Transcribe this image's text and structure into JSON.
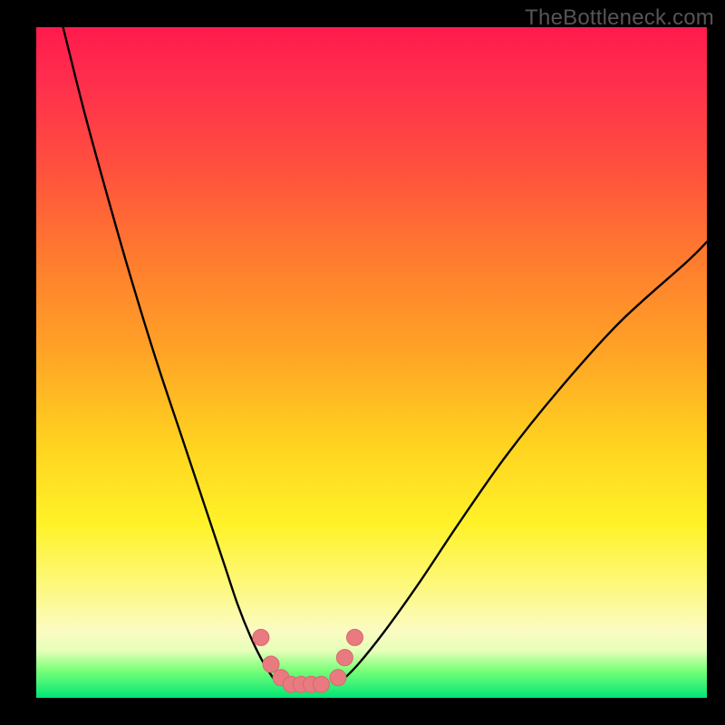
{
  "brand": "TheBottleneck.com",
  "colors": {
    "frame": "#000000",
    "curve": "#000000",
    "marker_fill": "#e87a80",
    "marker_stroke": "#d66a70",
    "gradient_top": "#ff1a4d",
    "gradient_bottom": "#00e676"
  },
  "chart_data": {
    "type": "line",
    "title": "",
    "xlabel": "",
    "ylabel": "",
    "xlim": [
      0,
      100
    ],
    "ylim": [
      0,
      100
    ],
    "grid": false,
    "legend": false,
    "note": "V-shaped bottleneck curve; y approaches 0 (green) near x≈35–45 and rises toward 100 (red) at both extremes. Values estimated from pixel positions.",
    "series": [
      {
        "name": "left-branch",
        "x": [
          4,
          7,
          10,
          14,
          18,
          22,
          25,
          28,
          30,
          32,
          34,
          36
        ],
        "y": [
          100,
          88,
          77,
          63,
          50,
          38,
          29,
          20,
          14,
          9,
          5,
          2
        ]
      },
      {
        "name": "right-branch",
        "x": [
          45,
          48,
          52,
          57,
          63,
          70,
          78,
          87,
          97,
          100
        ],
        "y": [
          2,
          5,
          10,
          17,
          26,
          36,
          46,
          56,
          65,
          68
        ]
      }
    ],
    "markers": {
      "name": "trough-points",
      "x": [
        33.5,
        35,
        36.5,
        38,
        39.5,
        41,
        42.5,
        45,
        46,
        47.5
      ],
      "y": [
        9,
        5,
        3,
        2,
        2,
        2,
        2,
        3,
        6,
        9
      ]
    }
  }
}
